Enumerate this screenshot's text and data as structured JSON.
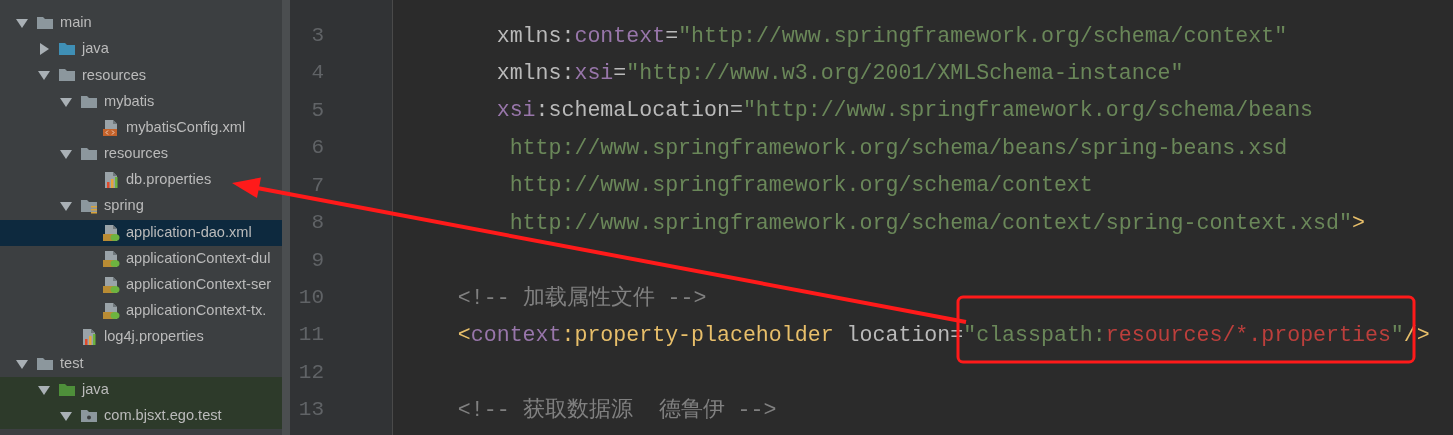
{
  "project_tree": [
    {
      "label": "main",
      "kind": "folder",
      "expanded": true,
      "selected": false,
      "children": [
        {
          "label": "java",
          "kind": "source-folder",
          "expanded": false,
          "selected": false
        },
        {
          "label": "resources",
          "kind": "folder",
          "expanded": true,
          "selected": false,
          "children": [
            {
              "label": "mybatis",
              "kind": "folder",
              "expanded": true,
              "selected": false,
              "children": [
                {
                  "label": "mybatisConfig.xml",
                  "kind": "xml-file",
                  "selected": false
                }
              ]
            },
            {
              "label": "resources",
              "kind": "folder",
              "expanded": true,
              "selected": false,
              "children": [
                {
                  "label": "db.properties",
                  "kind": "properties-file",
                  "selected": false
                }
              ]
            },
            {
              "label": "spring",
              "kind": "spring-folder",
              "expanded": true,
              "selected": false,
              "children": [
                {
                  "label": "application-dao.xml",
                  "kind": "spring-xml-file",
                  "selected": true
                },
                {
                  "label": "applicationContext-dul",
                  "kind": "spring-xml-file",
                  "selected": false
                },
                {
                  "label": "applicationContext-ser",
                  "kind": "spring-xml-file",
                  "selected": false
                },
                {
                  "label": "applicationContext-tx.",
                  "kind": "spring-xml-file",
                  "selected": false
                }
              ]
            },
            {
              "label": "log4j.properties",
              "kind": "properties-file",
              "selected": false
            }
          ]
        }
      ]
    },
    {
      "label": "test",
      "kind": "folder",
      "expanded": true,
      "selected": false,
      "children": [
        {
          "label": "java",
          "kind": "test-folder",
          "expanded": true,
          "selected": false,
          "children": [
            {
              "label": "com.bjsxt.ego.test",
              "kind": "package",
              "expanded": true,
              "selected": false
            }
          ]
        }
      ]
    }
  ],
  "editor_lines": [
    {
      "number": "3",
      "segments": [
        {
          "kind": "attr",
          "text": "        xmlns:"
        },
        {
          "kind": "ns",
          "text": "context"
        },
        {
          "kind": "attr",
          "text": "="
        },
        {
          "kind": "value",
          "text": "\"http://www.springframework.org/schema/context\""
        }
      ]
    },
    {
      "number": "4",
      "segments": [
        {
          "kind": "attr",
          "text": "        xmlns:"
        },
        {
          "kind": "ns",
          "text": "xsi"
        },
        {
          "kind": "attr",
          "text": "="
        },
        {
          "kind": "value",
          "text": "\"http://www.w3.org/2001/XMLSchema-instance\""
        }
      ]
    },
    {
      "number": "5",
      "segments": [
        {
          "kind": "ns",
          "text": "        xsi"
        },
        {
          "kind": "attr",
          "text": ":schemaLocation="
        },
        {
          "kind": "value",
          "text": "\"http://www.springframework.org/schema/beans"
        }
      ]
    },
    {
      "number": "6",
      "segments": [
        {
          "kind": "value",
          "text": "         http://www.springframework.org/schema/beans/spring-beans.xsd"
        }
      ]
    },
    {
      "number": "7",
      "segments": [
        {
          "kind": "value",
          "text": "         http://www.springframework.org/schema/context"
        }
      ]
    },
    {
      "number": "8",
      "segments": [
        {
          "kind": "value",
          "text": "         http://www.springframework.org/schema/context/spring-context.xsd\""
        },
        {
          "kind": "tag",
          "text": ">"
        }
      ]
    },
    {
      "number": "9"
    },
    {
      "number": "10",
      "segments": [
        {
          "kind": "comment",
          "text": "     <!-- 加载属性文件 -->"
        }
      ]
    },
    {
      "number": "11",
      "segments": [
        {
          "kind": "tag",
          "text": "     <"
        },
        {
          "kind": "ns",
          "text": "context"
        },
        {
          "kind": "tag",
          "text": ":property-placeholder"
        },
        {
          "kind": "attr",
          "text": " location="
        },
        {
          "kind": "value",
          "text": "\"classpath:"
        },
        {
          "kind": "error",
          "text": "resources/*.properties"
        },
        {
          "kind": "value",
          "text": "\""
        },
        {
          "kind": "tag",
          "text": "/>"
        }
      ]
    },
    {
      "number": "12"
    },
    {
      "number": "13",
      "segments": [
        {
          "kind": "comment",
          "text": "     <!-- 获取数据源  德鲁伊 -->"
        }
      ]
    }
  ]
}
